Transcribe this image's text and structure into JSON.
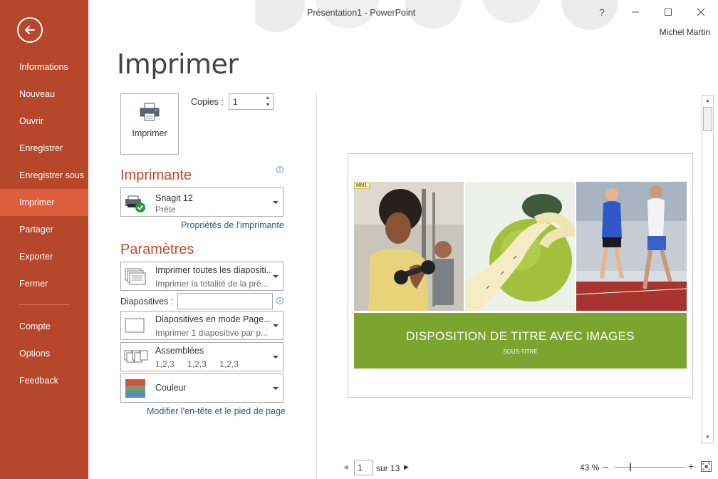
{
  "window": {
    "title": "Présentation1 - PowerPoint",
    "help": "?",
    "user": "Michel Martin"
  },
  "sidebar": {
    "items": [
      {
        "label": "Informations"
      },
      {
        "label": "Nouveau"
      },
      {
        "label": "Ouvrir"
      },
      {
        "label": "Enregistrer"
      },
      {
        "label": "Enregistrer sous"
      },
      {
        "label": "Imprimer",
        "active": true
      },
      {
        "label": "Partager"
      },
      {
        "label": "Exporter"
      },
      {
        "label": "Fermer"
      },
      {
        "label": "Compte"
      },
      {
        "label": "Options"
      },
      {
        "label": "Feedback"
      }
    ]
  },
  "print": {
    "page_title": "Imprimer",
    "button_label": "Imprimer",
    "copies_label": "Copies :",
    "copies_value": "1"
  },
  "printer": {
    "heading": "Imprimante",
    "name": "Snagit 12",
    "status": "Prête",
    "properties_link": "Propriétés de l'imprimante"
  },
  "settings": {
    "heading": "Paramètres",
    "range_title": "Imprimer toutes les diapositi...",
    "range_sub": "Imprimer la totalité de la pré...",
    "slides_label": "Diapositives :",
    "slides_value": "",
    "layout_title": "Diapositives en mode Page...",
    "layout_sub": "Imprimer 1 diapositive par p...",
    "collate_title": "Assemblées",
    "collate_values": [
      "1,2,3",
      "1,2,3",
      "1,2,3"
    ],
    "color_title": "Couleur",
    "header_footer_link": "Modifier l'en-tête et le pied de page"
  },
  "preview": {
    "tag": "MM1",
    "slide_title": "DISPOSITION DE TITRE AVEC IMAGES",
    "slide_subtitle": "SOUS-TITRE",
    "accent": "#7ba52f"
  },
  "pager": {
    "current": "1",
    "of_text": "sur 13"
  },
  "zoom": {
    "level": "43 %",
    "level_value": 43
  },
  "colors": {
    "sidebar_bg": "#b7472a",
    "sidebar_active": "#dc5f3d",
    "heading": "#c5492c",
    "link": "#2b579a"
  }
}
